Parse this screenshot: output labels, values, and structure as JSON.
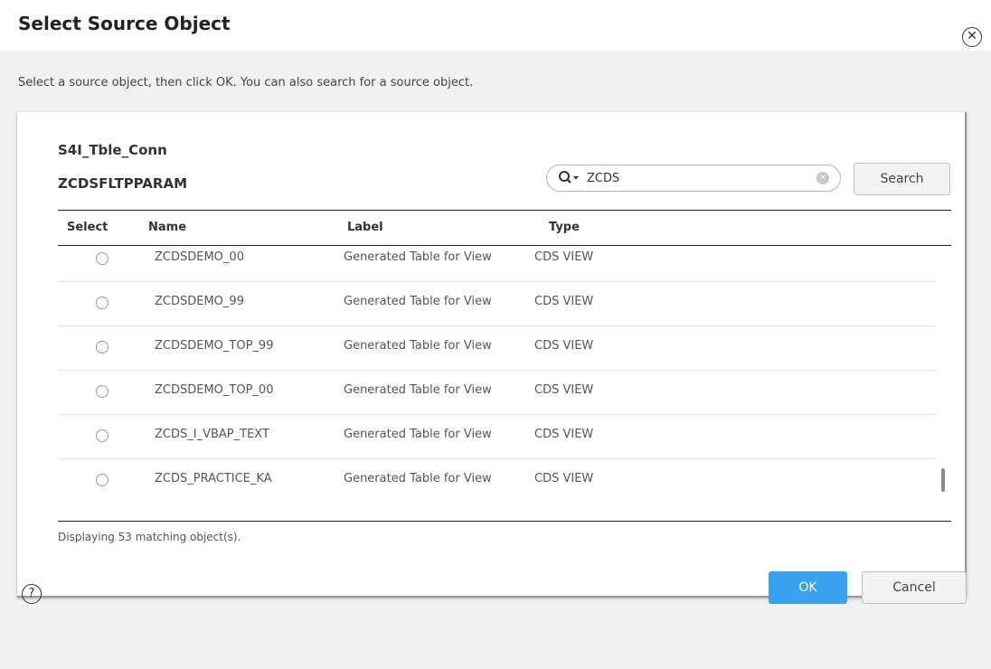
{
  "dialog": {
    "title": "Select Source Object",
    "close_glyph": "✕",
    "instruction": "Select a source object, then click OK. You can also search for a source object."
  },
  "panel": {
    "connection": "S4I_Tble_Conn",
    "selected_object": "ZCDSFLTPPARAM",
    "search": {
      "value": "ZCDS",
      "icon": "search-icon",
      "clear_icon": "clear-icon",
      "button_label": "Search"
    },
    "columns": [
      "Select",
      "Name",
      "Label",
      "Type"
    ],
    "rows": [
      {
        "name": "ZCDSDEMO_00",
        "label": "Generated Table for View",
        "type": "CDS VIEW"
      },
      {
        "name": "ZCDSDEMO_99",
        "label": "Generated Table for View",
        "type": "CDS VIEW"
      },
      {
        "name": "ZCDSDEMO_TOP_99",
        "label": "Generated Table for View",
        "type": "CDS VIEW"
      },
      {
        "name": "ZCDSDEMO_TOP_00",
        "label": "Generated Table for View",
        "type": "CDS VIEW"
      },
      {
        "name": "ZCDS_I_VBAP_TEXT",
        "label": "Generated Table for View",
        "type": "CDS VIEW"
      },
      {
        "name": "ZCDS_PRACTICE_KA",
        "label": "Generated Table for View",
        "type": "CDS VIEW"
      }
    ],
    "match_count": "Displaying 53 matching object(s)."
  },
  "footer": {
    "help_glyph": "?",
    "ok_label": "OK",
    "cancel_label": "Cancel"
  },
  "colors": {
    "ok_button": "#3aa1ef",
    "body_bg": "#f1f1f1"
  }
}
